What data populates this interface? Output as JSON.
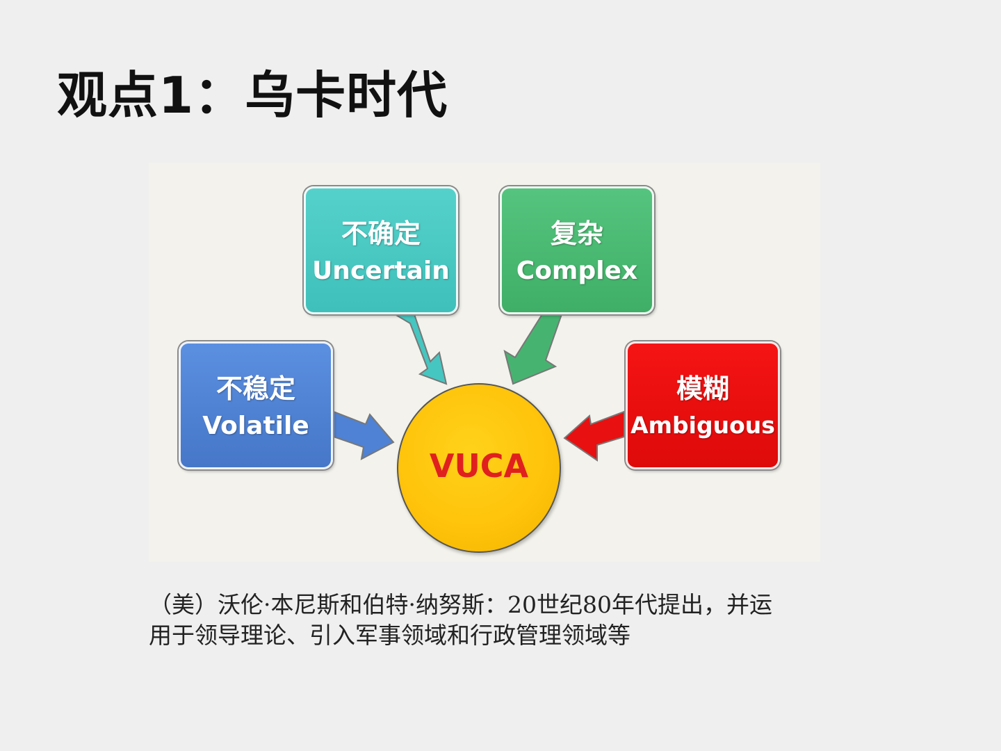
{
  "slide": {
    "title": "观点1：乌卡时代"
  },
  "diagram": {
    "center": {
      "label": "VUCA",
      "color": "#ffc20a",
      "text_color": "#e0201e"
    },
    "nodes": [
      {
        "id": "uncertain",
        "zh": "不确定",
        "en": "Uncertain",
        "color": "#48c8c2"
      },
      {
        "id": "complex",
        "zh": "复杂",
        "en": "Complex",
        "color": "#48b872"
      },
      {
        "id": "volatile",
        "zh": "不稳定",
        "en": "Volatile",
        "color": "#4f82d4"
      },
      {
        "id": "ambiguous",
        "zh": "模糊",
        "en": "Ambiguous",
        "color": "#ee1010"
      }
    ]
  },
  "caption": {
    "line1": "（美）沃伦·本尼斯和伯特·纳努斯：20世纪80年代提出，并运",
    "line2": "用于领导理论、引入军事领域和行政管理领域等"
  }
}
